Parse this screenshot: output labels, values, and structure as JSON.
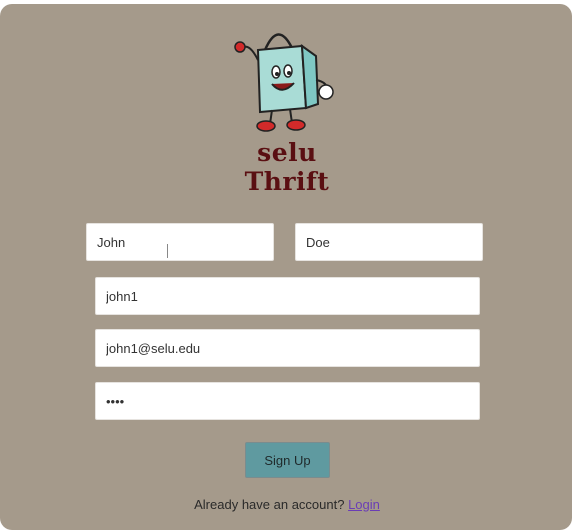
{
  "brand": {
    "name": "selu Thrift",
    "tagline": "",
    "logo_colors": {
      "bag": "#7fc8c4",
      "shoes": "#d22a2a",
      "text": "#5a0f12"
    }
  },
  "form": {
    "first_name": "John",
    "last_name": "Doe",
    "username": "john1",
    "email": "john1@selu.edu",
    "password": "••••",
    "submit_label": "Sign Up"
  },
  "footer": {
    "prompt": "Already have an account? ",
    "login_link": "Login"
  },
  "colors": {
    "card_bg": "#a59a8b",
    "button_bg": "#5f9aa0",
    "link": "#6a3db5"
  }
}
